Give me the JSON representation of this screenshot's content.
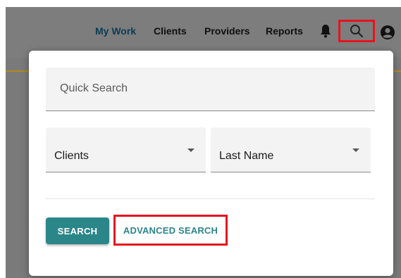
{
  "nav": {
    "items": [
      {
        "label": "My Work"
      },
      {
        "label": "Clients"
      },
      {
        "label": "Providers"
      },
      {
        "label": "Reports"
      }
    ],
    "icons": [
      "bell-icon",
      "search-icon",
      "user-circle-icon"
    ]
  },
  "search_modal": {
    "quick_search_placeholder": "Quick Search",
    "quick_search_value": "",
    "category_select": {
      "value": "Clients"
    },
    "field_select": {
      "value": "Last Name"
    },
    "search_button_label": "SEARCH",
    "advanced_search_label": "ADVANCED SEARCH"
  },
  "colors": {
    "accent_teal": "#2b8689",
    "highlight_red": "#e5141f",
    "active_nav": "#0c3c54"
  }
}
